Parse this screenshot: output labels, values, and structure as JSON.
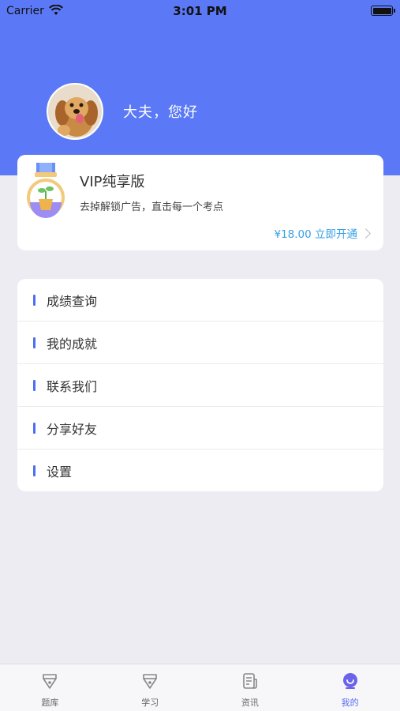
{
  "status_bar": {
    "carrier": "Carrier",
    "time": "3:01 PM"
  },
  "profile": {
    "greeting": "大夫，您好"
  },
  "vip": {
    "title": "VIP纯享版",
    "description": "去掉解锁广告，直击每一个考点",
    "price_cta": "¥18.00 立即开通"
  },
  "menu": {
    "items": [
      {
        "label": "成绩查询"
      },
      {
        "label": "我的成就"
      },
      {
        "label": "联系我们"
      },
      {
        "label": "分享好友"
      },
      {
        "label": "设置"
      }
    ]
  },
  "tabbar": {
    "tabs": [
      {
        "label": "题库",
        "icon": "pen-nib-icon"
      },
      {
        "label": "学习",
        "icon": "pen-nib-icon"
      },
      {
        "label": "资讯",
        "icon": "news-icon"
      },
      {
        "label": "我的",
        "icon": "profile-icon"
      }
    ],
    "active_index": 3
  },
  "colors": {
    "accent": "#5b79f6",
    "link": "#37a0e6",
    "menu_marker": "#4d6df3"
  }
}
